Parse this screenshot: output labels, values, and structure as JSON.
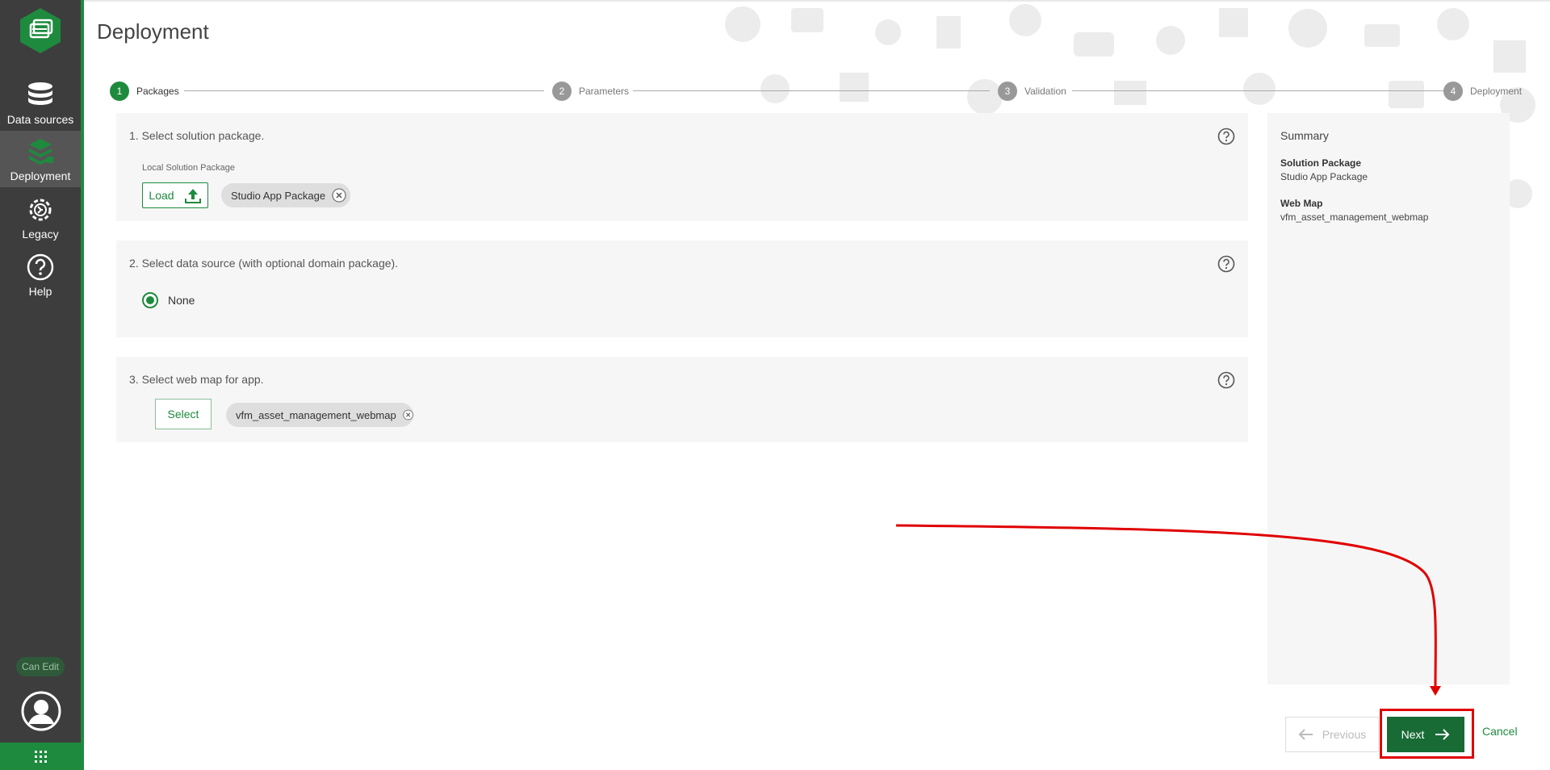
{
  "sidebar": {
    "items": [
      {
        "label": "Data sources",
        "icon": "database-icon"
      },
      {
        "label": "Deployment",
        "icon": "deployment-layers-icon"
      },
      {
        "label": "Legacy",
        "icon": "legacy-gear-icon"
      },
      {
        "label": "Help",
        "icon": "help-icon"
      }
    ],
    "can_edit": "Can Edit"
  },
  "page": {
    "title": "Deployment"
  },
  "stepper": {
    "steps": [
      {
        "num": "1",
        "label": "Packages"
      },
      {
        "num": "2",
        "label": "Parameters"
      },
      {
        "num": "3",
        "label": "Validation"
      },
      {
        "num": "4",
        "label": "Deployment"
      }
    ]
  },
  "panels": {
    "solution": {
      "title": "1. Select solution package.",
      "sublabel": "Local Solution Package",
      "load_label": "Load",
      "chip": "Studio App Package"
    },
    "datasource": {
      "title": "2. Select data source (with optional domain package).",
      "option": "None"
    },
    "webmap": {
      "title": "3. Select web map for app.",
      "select_label": "Select",
      "chip": "vfm_asset_management_webmap"
    }
  },
  "summary": {
    "title": "Summary",
    "solution_key": "Solution Package",
    "solution_value": "Studio App Package",
    "webmap_key": "Web Map",
    "webmap_value": "vfm_asset_management_webmap"
  },
  "footer": {
    "previous": "Previous",
    "next": "Next",
    "cancel": "Cancel"
  },
  "colors": {
    "accent": "#1e8a3e",
    "sidebar": "#3d3d3d",
    "annotation": "#e00000"
  }
}
